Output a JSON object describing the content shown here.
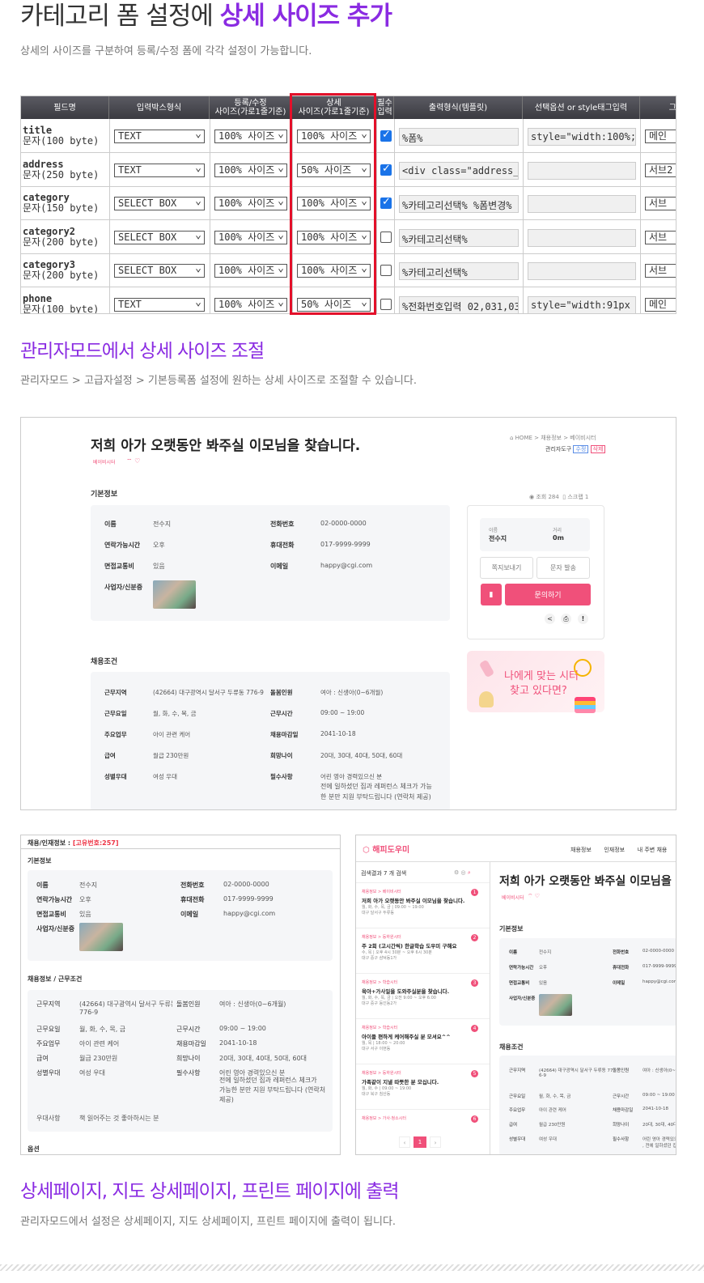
{
  "heading1": {
    "plain": "카테고리 폼 설정에 ",
    "highlight": "상세 사이즈 추가"
  },
  "heading1_sub": "상세의 사이즈를 구분하여 등록/수정 폼에 각각 설정이 가능합니다.",
  "table": {
    "headers": [
      "필드명",
      "입력박스형식",
      "등록/수정\n사이즈(가로1줄기준)",
      "상세\n사이즈(가로1줄기준)",
      "필수\n입력",
      "출력형식(템플릿)",
      "선택옵션 or style태그입력",
      "그룹"
    ],
    "rows": [
      {
        "name": "title",
        "type_label": "문자(100 byte)",
        "input_type": "TEXT",
        "reg_size": "100% 사이즈",
        "detail_size": "100% 사이즈",
        "required": true,
        "template": "%폼%",
        "option": "style=\"width:100%;\"",
        "group": "메인"
      },
      {
        "name": "address",
        "type_label": "문자(250 byte)",
        "input_type": "TEXT",
        "reg_size": "100% 사이즈",
        "detail_size": "50% 사이즈",
        "required": true,
        "template": "<div class=\"address_01 p",
        "option": "",
        "group": "서브2"
      },
      {
        "name": "category",
        "type_label": "문자(150 byte)",
        "input_type": "SELECT BOX",
        "reg_size": "100% 사이즈",
        "detail_size": "100% 사이즈",
        "required": true,
        "template": "%카테고리선택% %폼변경%",
        "option": "",
        "group": "서브"
      },
      {
        "name": "category2",
        "type_label": "문자(200 byte)",
        "input_type": "SELECT BOX",
        "reg_size": "100% 사이즈",
        "detail_size": "100% 사이즈",
        "required": false,
        "template": "%카테고리선택%",
        "option": "",
        "group": "서브"
      },
      {
        "name": "category3",
        "type_label": "문자(200 byte)",
        "input_type": "SELECT BOX",
        "reg_size": "100% 사이즈",
        "detail_size": "100% 사이즈",
        "required": false,
        "template": "%카테고리선택%",
        "option": "",
        "group": "서브"
      },
      {
        "name": "phone",
        "type_label": "문자(100 byte)",
        "input_type": "TEXT",
        "reg_size": "100% 사이즈",
        "detail_size": "50% 사이즈",
        "required": false,
        "template": "%전화번호입력 02,031,032,",
        "option": "style=\"width:91px !impo",
        "group": "메인"
      }
    ]
  },
  "heading2": "관리자모드에서 상세 사이즈 조절",
  "heading2_sub": "관리자모드 > 고급자설정 > 기본등록폼 설정에 원하는 상세 사이즈로 조절할 수 있습니다.",
  "detail": {
    "title": "저희 아가 오랫동안 봐주실 이모님을 찾습니다.",
    "tag": "베이비시터",
    "breadcrumb": "HOME > 채용정보 > 베이비시터",
    "admin_tools": "관리자도구",
    "edit": "수정",
    "delete": "삭제",
    "section_basic": "기본정보",
    "views": "조회 284",
    "scrap": "스크랩 1",
    "basic": [
      {
        "l": "이름",
        "v": "전수지",
        "l2": "전화번호",
        "v2": "02-0000-0000"
      },
      {
        "l": "연락가능시간",
        "v": "오후",
        "l2": "휴대전화",
        "v2": "017-9999-9999"
      },
      {
        "l": "면접교통비",
        "v": "있음",
        "l2": "이메일",
        "v2": "happy@cgi.com"
      },
      {
        "l": "사업자/신분증",
        "v": "",
        "l2": "",
        "v2": ""
      }
    ],
    "side": {
      "name_label": "이름",
      "name": "전수지",
      "dist_label": "거리",
      "dist": "0m",
      "msg_btn": "쪽지보내기",
      "sms_btn": "문자 발송",
      "inquiry": "문의하기"
    },
    "banner": {
      "line1": "나에게 맞는 시터",
      "line2": "찾고 있다면?"
    },
    "section_cond": "채용조건",
    "cond": [
      {
        "l": "근무지역",
        "v": "(42664) 대구광역시 달서구 두류동 776-9",
        "l2": "돌봄인원",
        "v2": "여아 : 신생아(0~6개월)"
      },
      {
        "l": "근무요일",
        "v": "월, 화, 수, 목, 금",
        "l2": "근무시간",
        "v2": "09:00 ~ 19:00"
      },
      {
        "l": "주요업무",
        "v": "아이 관련 케어",
        "l2": "채용마감일",
        "v2": "2041-10-18"
      },
      {
        "l": "급여",
        "v": "월급 230만원",
        "l2": "희망나이",
        "v2": "20대, 30대, 40대, 50대, 60대"
      },
      {
        "l": "성별우대",
        "v": "여성 우대",
        "l2": "필수사항",
        "v2": "어린 영아 경력있으신 분"
      }
    ],
    "cond_extra": [
      "전에 일하셨던 집과 레퍼런스 체크가 가능",
      "한 분만 지원 부탁드립니다 (연락처 제공)"
    ]
  },
  "print": {
    "header_label": "채용/인재정보 :",
    "header_id": "[고유번호:257]",
    "section_basic": "기본정보",
    "section_cond": "채용정보 / 근무조건",
    "address2": "776-9",
    "extra_row": {
      "l": "우대사항",
      "v": "책 읽어주는 것 좋아하시는 분"
    },
    "cond_extra": [
      "전에 일하셨던 집과 레퍼런스 체크가",
      "가능한 분만 지원 부탁드립니다 (연락처",
      "제공)"
    ],
    "footer": "옵션"
  },
  "map": {
    "logo": "해피도우미",
    "nav": [
      "채용정보",
      "인재정보",
      "내 주변 채용"
    ],
    "search_result": "검색결과 7 개 검색",
    "list": [
      {
        "tag": "채용정보 > 베이비시터",
        "title": "저희 아가 오랫동안 봐주실 이모님을 찾습니다.",
        "sub1": "월, 화, 수, 목, 금 | 09:00 ~ 19:00",
        "sub2": "대구 달서구 두류동",
        "n": "1"
      },
      {
        "tag": "채용정보 > 등하원시터",
        "title": "주 2회 (고시간씩) 한글학습 도우미 구해요",
        "sub1": "수, 목 | 오후 4시 30분 ~ 오후 6시 30분",
        "sub2": "대구 중구 삼덕동1가",
        "n": "2"
      },
      {
        "tag": "채용정보 > 학습시터",
        "title": "육아+가사일을 도와주실분을 찾습니다.",
        "sub1": "월, 화, 수, 목, 금 | 오전 9:00 ~ 오후 6:00",
        "sub2": "대구 중구 동인동2가",
        "n": "3"
      },
      {
        "tag": "채용정보 > 학습시터",
        "title": "아이들 편하게 케어해주실 분 모셔요^^",
        "sub1": "월, 목 | 18:00 ~ 20:00",
        "sub2": "대구 서구 이현동",
        "n": "4"
      },
      {
        "tag": "채용정보 > 등하원시터",
        "title": "가족같이 지낼 따뜻한 분 모십니다.",
        "sub1": "월, 화, 수 | 09:00 ~ 19:00",
        "sub2": "대구 북구 침산동",
        "n": "5"
      },
      {
        "tag": "채용정보 > 가사·청소시터",
        "title": "",
        "sub1": "",
        "sub2": "",
        "n": "6"
      }
    ],
    "page": "1",
    "title": "저희 아가 오랫동안 봐주실 이모님을 찾",
    "address_short": "(42664) 대구광역시 달서구 두류동 77",
    "address_cut": "6-9",
    "care_short": "여아 : 신생아(0~6",
    "extra_short": [
      "어린 영아 경력있으",
      ", 전에 일하셨던 집"
    ]
  },
  "heading3": "상세페이지, 지도 상세페이지, 프린트 페이지에 출력",
  "heading3_sub": "관리자모드에서 설정은 상세페이지, 지도 상세페이지, 프린트 페이지에 출력이 됩니다.",
  "colors": {
    "accent": "#8a2be2",
    "pink": "#f0507a",
    "red": "#e3102a"
  }
}
